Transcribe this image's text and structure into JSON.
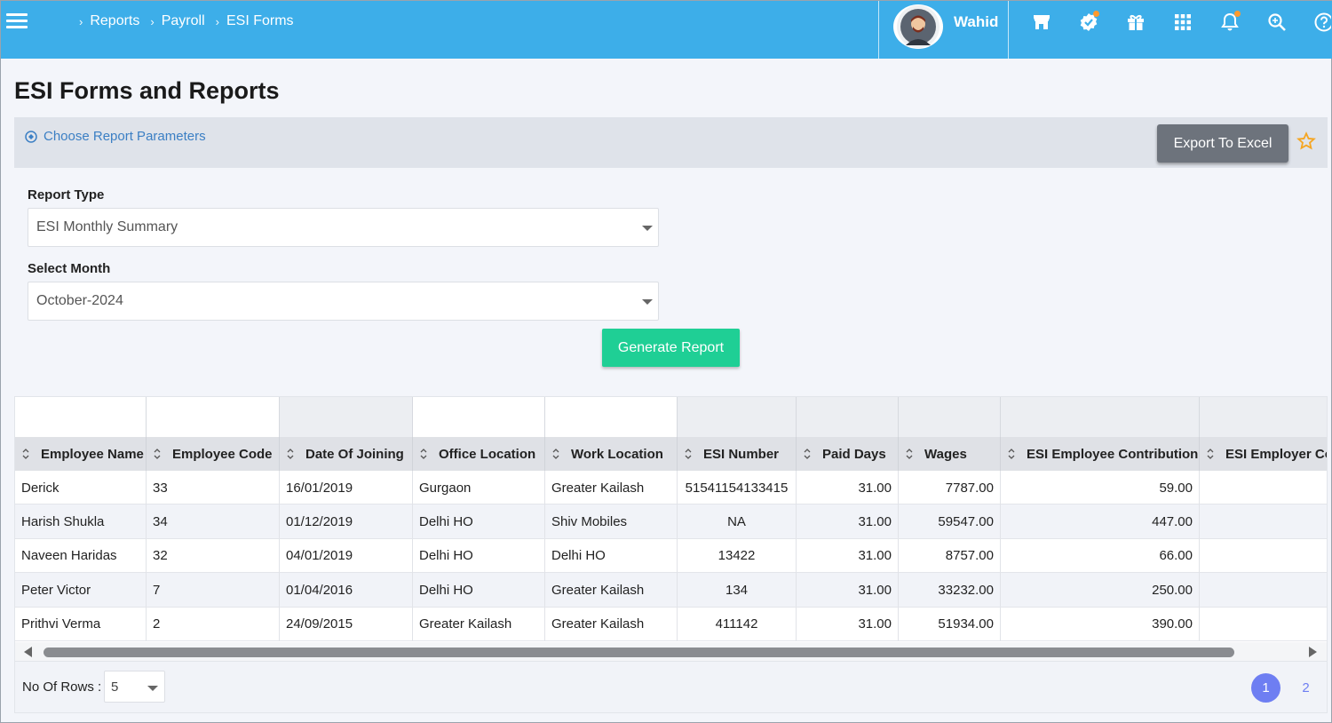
{
  "header": {
    "breadcrumbs": [
      "Reports",
      "Payroll",
      "ESI Forms"
    ],
    "user_name": "Wahid",
    "icons": [
      "store-icon",
      "verified-badge-icon",
      "gift-icon",
      "apps-grid-icon",
      "bell-icon",
      "search-zoom-icon",
      "help-icon"
    ]
  },
  "page": {
    "title": "ESI Forms and Reports",
    "params_link": "Choose Report Parameters",
    "export_label": "Export To Excel",
    "report_type_label": "Report Type",
    "report_type_value": "ESI Monthly Summary",
    "month_label": "Select Month",
    "month_value": "October-2024",
    "generate_label": "Generate Report"
  },
  "table": {
    "columns": [
      "Employee Name",
      "Employee Code",
      "Date Of Joining",
      "Office Location",
      "Work Location",
      "ESI Number",
      "Paid Days",
      "Wages",
      "ESI Employee Contribution",
      "ESI Employer Co"
    ],
    "rows": [
      [
        "Derick",
        "33",
        "16/01/2019",
        "Gurgaon",
        "Greater Kailash",
        "51541154133415",
        "31.00",
        "7787.00",
        "59.00",
        ""
      ],
      [
        "Harish Shukla",
        "34",
        "01/12/2019",
        "Delhi HO",
        "Shiv Mobiles",
        "NA",
        "31.00",
        "59547.00",
        "447.00",
        ""
      ],
      [
        "Naveen Haridas",
        "32",
        "04/01/2019",
        "Delhi HO",
        "Delhi HO",
        "13422",
        "31.00",
        "8757.00",
        "66.00",
        ""
      ],
      [
        "Peter Victor",
        "7",
        "01/04/2016",
        "Delhi HO",
        "Greater Kailash",
        "134",
        "31.00",
        "33232.00",
        "250.00",
        ""
      ],
      [
        "Prithvi Verma",
        "2",
        "24/09/2015",
        "Greater Kailash",
        "Greater Kailash",
        "411142",
        "31.00",
        "51934.00",
        "390.00",
        ""
      ]
    ]
  },
  "footer": {
    "rows_label": "No Of Rows :",
    "rows_value": "5",
    "pages": [
      "1",
      "2"
    ],
    "active_page": "1"
  },
  "colors": {
    "header_bg": "#3daee9",
    "generate_btn": "#1fcf95",
    "export_btn": "#6d737c",
    "page_active": "#6e7ef2",
    "link": "#3b7fc4",
    "star": "#f5a623"
  }
}
